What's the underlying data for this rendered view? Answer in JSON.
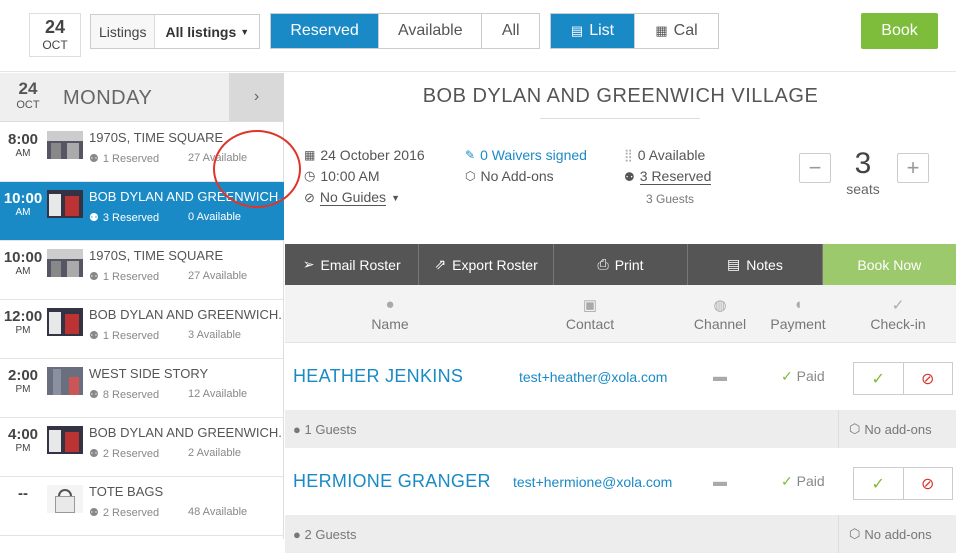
{
  "topbar": {
    "date_day": "24",
    "date_month": "OCT",
    "listings_label": "Listings",
    "listings_value": "All listings",
    "filter_tabs": [
      "Reserved",
      "Available",
      "All"
    ],
    "view_tabs": [
      "List",
      "Cal"
    ],
    "book_label": "Book"
  },
  "sidebar": {
    "day": "24",
    "month": "OCT",
    "weekday": "MONDAY",
    "next_icon": "chevron-right-icon",
    "slots": [
      {
        "time": "8:00",
        "ampm": "AM",
        "title": "1970S, TIME SQUARE",
        "reserved": "1 Reserved",
        "available": "27 Available"
      },
      {
        "time": "10:00",
        "ampm": "AM",
        "title": "BOB DYLAN AND GREENWICH...",
        "reserved": "3 Reserved",
        "available": "0 Available"
      },
      {
        "time": "10:00",
        "ampm": "AM",
        "title": "1970S, TIME SQUARE",
        "reserved": "1 Reserved",
        "available": "27 Available"
      },
      {
        "time": "12:00",
        "ampm": "PM",
        "title": "BOB DYLAN AND GREENWICH...",
        "reserved": "1 Reserved",
        "available": "3 Available"
      },
      {
        "time": "2:00",
        "ampm": "PM",
        "title": "WEST SIDE STORY",
        "reserved": "8 Reserved",
        "available": "12 Available"
      },
      {
        "time": "4:00",
        "ampm": "PM",
        "title": "BOB DYLAN AND GREENWICH...",
        "reserved": "2 Reserved",
        "available": "2 Available"
      },
      {
        "time": "--",
        "ampm": "",
        "title": "TOTE BAGS",
        "reserved": "2 Reserved",
        "available": "48 Available"
      }
    ]
  },
  "event": {
    "title": "BOB DYLAN AND GREENWICH VILLAGE",
    "date": "24 October 2016",
    "time": "10:00 AM",
    "guides": "No Guides",
    "waivers": "0 Waivers signed",
    "addons": "No Add-ons",
    "available": "0 Available",
    "reserved": "3 Reserved",
    "guests": "3 Guests",
    "seats_value": "3",
    "seats_label": "seats",
    "minus": "−",
    "plus": "+"
  },
  "actions": {
    "email": "Email Roster",
    "export": "Export Roster",
    "print": "Print",
    "notes": "Notes",
    "book_now": "Book Now"
  },
  "columns": {
    "name": "Name",
    "contact": "Contact",
    "channel": "Channel",
    "payment": "Payment",
    "checkin": "Check-in"
  },
  "guests": [
    {
      "name": "HEATHER JENKINS",
      "email": "test+heather@xola.com",
      "payment": "Paid",
      "guests": "1 Guests",
      "addons": "No add-ons"
    },
    {
      "name": "HERMIONE GRANGER",
      "email": "test+hermione@xola.com",
      "payment": "Paid",
      "guests": "2 Guests",
      "addons": "No add-ons"
    }
  ],
  "colors": {
    "accent": "#1a8ac6",
    "green": "#7ebd3b",
    "dark": "#555555",
    "highlight_circle": "#e0342a"
  }
}
